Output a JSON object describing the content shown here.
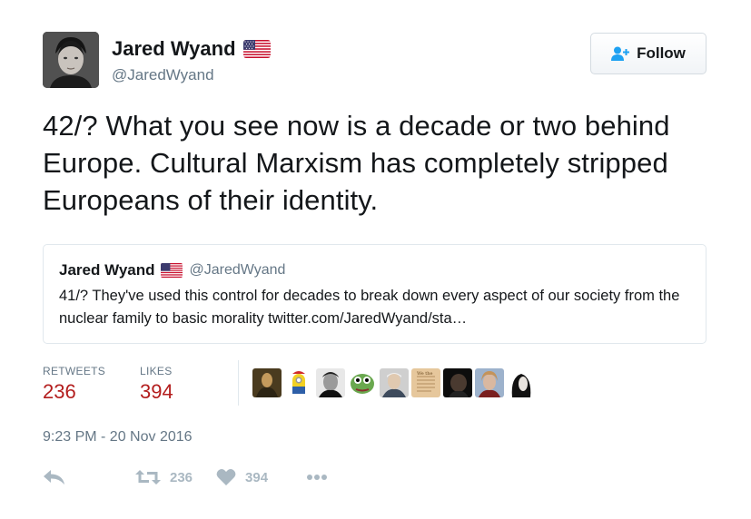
{
  "author": {
    "display_name": "Jared Wyand",
    "handle": "@JaredWyand"
  },
  "follow_button": {
    "label": "Follow"
  },
  "tweet": {
    "text": "42/? What you see now is a decade or two behind Europe. Cultural Marxism has completely stripped Europeans of their identity."
  },
  "quoted_tweet": {
    "display_name": "Jared Wyand",
    "handle": "@JaredWyand",
    "text": "41/? They've used this control for decades to break down every aspect of our society from the nuclear family to basic morality twitter.com/JaredWyand/sta…"
  },
  "stats": {
    "retweets_label": "RETWEETS",
    "retweets_value": "236",
    "likes_label": "LIKES",
    "likes_value": "394"
  },
  "timestamp": "9:23 PM - 20 Nov 2016",
  "actions": {
    "retweet_count": "236",
    "like_count": "394"
  },
  "colors": {
    "accent": "#1da1f2",
    "stat_value": "#b31d1d",
    "muted": "#657786",
    "action_icon": "#aab8c2"
  },
  "icons": [
    "us-flag-icon",
    "follow-person-icon",
    "reply-icon",
    "retweet-icon",
    "heart-icon",
    "more-icon"
  ]
}
